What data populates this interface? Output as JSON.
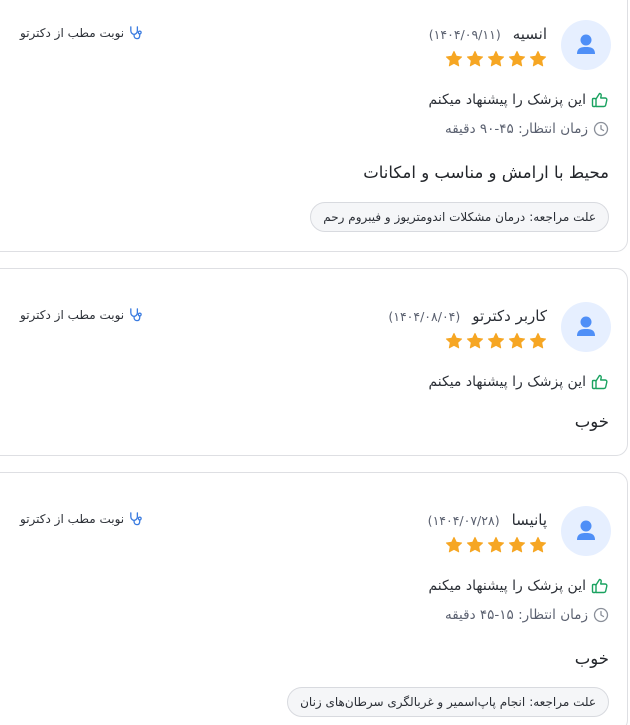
{
  "reviews": [
    {
      "user_name": "انسیه",
      "date": "(۱۴۰۴/۰۹/۱۱)",
      "rating": 5,
      "source_label": "نوبت مطب از دکترتو",
      "recommend_text": "این پزشک را پیشنهاد میکنم",
      "wait_time": "زمان انتظار: ۴۵-۹۰ دقیقه",
      "comment": "محیط با ارامش و مناسب و امکانات",
      "reason_label": "علت مراجعه:",
      "reason_value": "درمان مشکلات اندومتریوز و فیبروم رحم"
    },
    {
      "user_name": "کاربر دکترتو",
      "date": "(۱۴۰۴/۰۸/۰۴)",
      "rating": 5,
      "source_label": "نوبت مطب از دکترتو",
      "recommend_text": "این پزشک را پیشنهاد میکنم",
      "comment": "خوب"
    },
    {
      "user_name": "پانیسا",
      "date": "(۱۴۰۴/۰۷/۲۸)",
      "rating": 5,
      "source_label": "نوبت مطب از دکترتو",
      "recommend_text": "این پزشک را پیشنهاد میکنم",
      "wait_time": "زمان انتظار: ۱۵-۴۵ دقیقه",
      "comment": "خوب",
      "reason_label": "علت مراجعه:",
      "reason_value": "انجام پاپ‌اسمیر و غربالگری سرطان‌های زنان"
    }
  ],
  "colors": {
    "star": "#f6a623",
    "avatar_bg": "#e6efff",
    "avatar_fg": "#4f8ff7",
    "thumb": "#1aa260",
    "stethoscope": "#3a7be0",
    "clock": "#8a8f99",
    "border": "#dedfe3"
  },
  "icons": {
    "avatar": "user-avatar-icon",
    "recommend": "thumbs-up-icon",
    "wait": "clock-icon",
    "source": "stethoscope-icon",
    "rating": "star-icon"
  }
}
